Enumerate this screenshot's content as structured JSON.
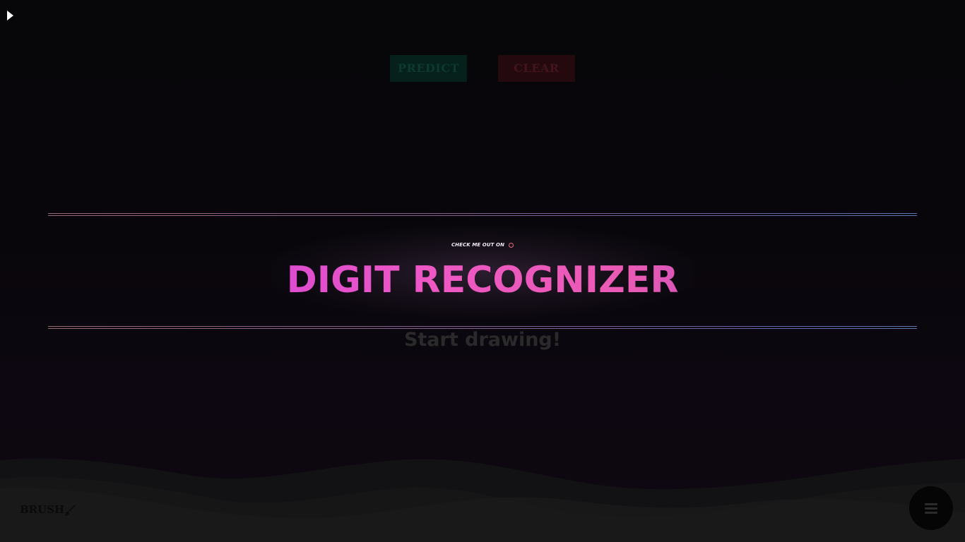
{
  "toolbar": {
    "predict_label": "PREDICT",
    "clear_label": "CLEAR"
  },
  "header": {
    "github_text": "CHECK ME OUT ON",
    "github_icon": "github-icon",
    "title": "DIGIT RECOGNIZER",
    "subtitle": "Start drawing!"
  },
  "footer": {
    "brush_label": "BRUSH",
    "brush_icon": "brush-icon",
    "menu_icon": "hamburger-menu-icon"
  },
  "colors": {
    "background": "#070509",
    "predict_bg": "#06201b",
    "clear_bg": "#240a0e",
    "title_gradient": [
      "#9a3de6",
      "#ee58c4",
      "#4d59b8"
    ]
  }
}
